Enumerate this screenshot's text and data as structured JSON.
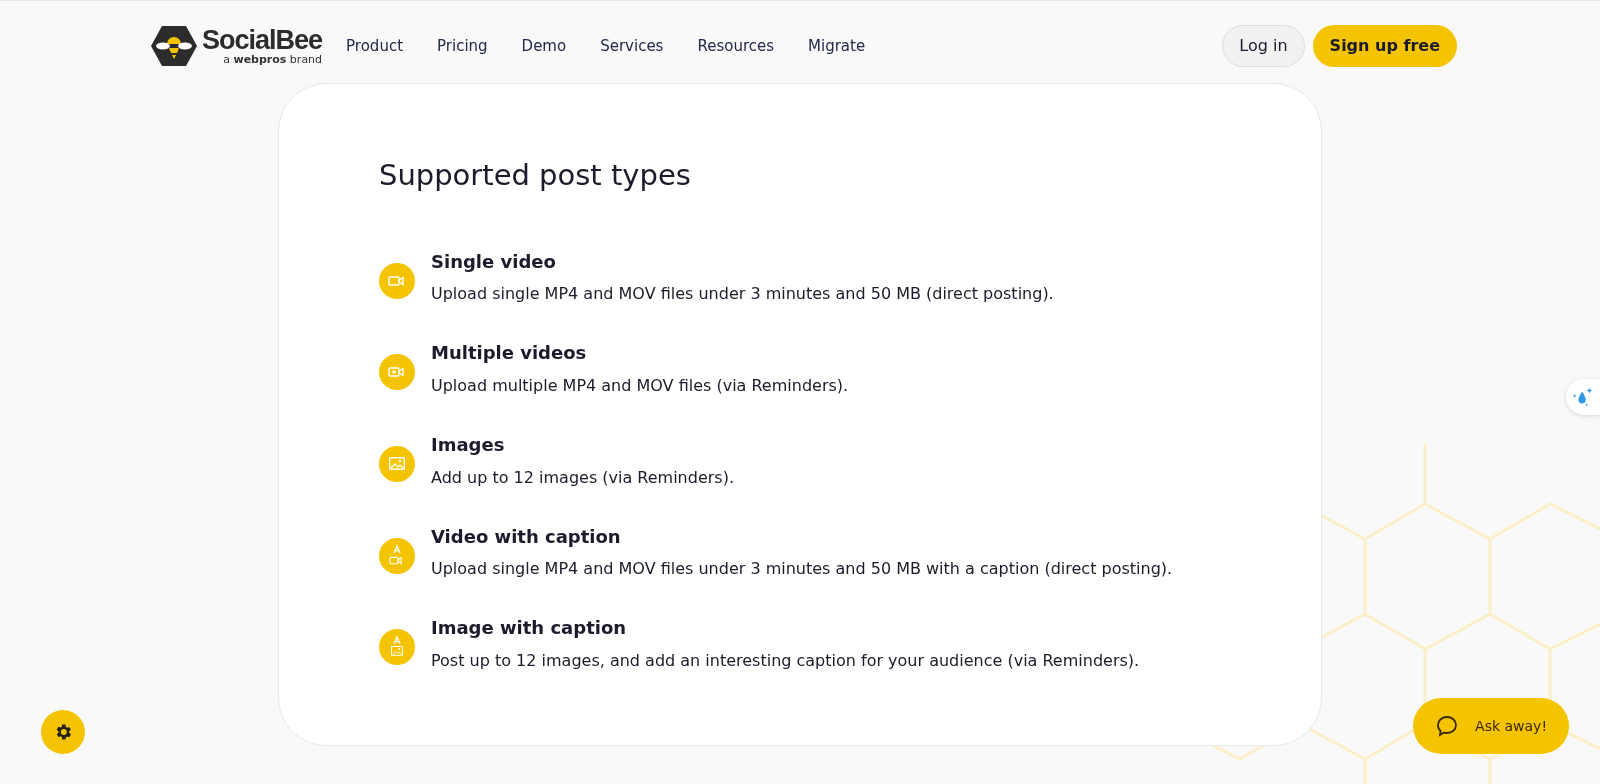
{
  "header": {
    "logo": {
      "name": "SocialBee",
      "tagline_prefix": "a",
      "tagline_brand": "webpros",
      "tagline_suffix": "brand"
    },
    "nav": [
      "Product",
      "Pricing",
      "Demo",
      "Services",
      "Resources",
      "Migrate"
    ],
    "login": "Log in",
    "signup": "Sign up free"
  },
  "section": {
    "title": "Supported post types",
    "items": [
      {
        "kind": "video",
        "title": "Single video",
        "text": "Upload single MP4 and MOV files under 3 minutes and 50 MB (direct posting)."
      },
      {
        "kind": "videos",
        "title": "Multiple videos",
        "text": "Upload multiple MP4 and MOV files (via Reminders)."
      },
      {
        "kind": "image",
        "title": "Images",
        "text": "Add up to 12 images (via Reminders)."
      },
      {
        "kind": "video_caption",
        "title": "Video with caption",
        "text": "Upload single MP4 and MOV files under 3 minutes and 50 MB with a caption (direct posting)."
      },
      {
        "kind": "image_caption",
        "title": "Image with caption",
        "text": "Post up to 12 images, and add an interesting caption for your audience (via Reminders)."
      }
    ]
  },
  "chat": {
    "label": "Ask away!"
  }
}
